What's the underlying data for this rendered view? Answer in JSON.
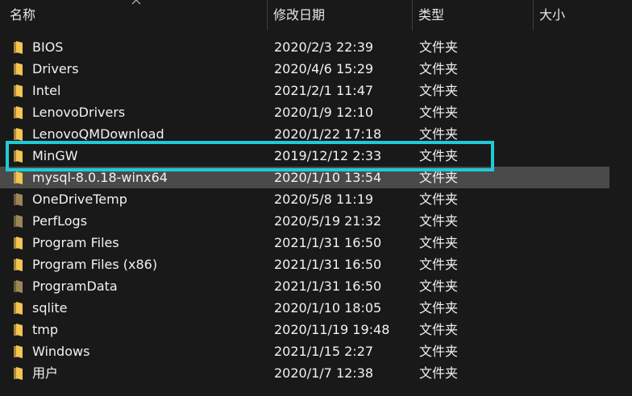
{
  "header": {
    "name_label": "名称",
    "date_label": "修改日期",
    "type_label": "类型",
    "size_label": "大小"
  },
  "colors": {
    "background": "#191919",
    "selected_row": "#4a4a4a",
    "highlight": "#1ecbd6",
    "folder_yellow": "#f5c451",
    "folder_dim": "#9c8656"
  },
  "rows": [
    {
      "name": "BIOS",
      "date": "2020/2/3 22:39",
      "type": "文件夹",
      "icon": "folder-icon"
    },
    {
      "name": "Drivers",
      "date": "2020/4/6 15:29",
      "type": "文件夹",
      "icon": "folder-icon"
    },
    {
      "name": "Intel",
      "date": "2021/2/1 11:47",
      "type": "文件夹",
      "icon": "folder-icon"
    },
    {
      "name": "LenovoDrivers",
      "date": "2020/1/9 12:10",
      "type": "文件夹",
      "icon": "folder-icon"
    },
    {
      "name": "LenovoQMDownload",
      "date": "2020/1/22 17:18",
      "type": "文件夹",
      "icon": "folder-icon"
    },
    {
      "name": "MinGW",
      "date": "2019/12/12 2:33",
      "type": "文件夹",
      "icon": "folder-icon"
    },
    {
      "name": "mysql-8.0.18-winx64",
      "date": "2020/1/10 13:54",
      "type": "文件夹",
      "icon": "folder-icon"
    },
    {
      "name": "OneDriveTemp",
      "date": "2020/5/8 11:19",
      "type": "文件夹",
      "icon": "folder-icon-dim"
    },
    {
      "name": "PerfLogs",
      "date": "2020/5/19 21:32",
      "type": "文件夹",
      "icon": "folder-icon-dim"
    },
    {
      "name": "Program Files",
      "date": "2021/1/31 16:50",
      "type": "文件夹",
      "icon": "folder-icon"
    },
    {
      "name": "Program Files (x86)",
      "date": "2021/1/31 16:50",
      "type": "文件夹",
      "icon": "folder-icon"
    },
    {
      "name": "ProgramData",
      "date": "2021/1/31 16:50",
      "type": "文件夹",
      "icon": "folder-icon-dim"
    },
    {
      "name": "sqlite",
      "date": "2020/1/10 18:05",
      "type": "文件夹",
      "icon": "folder-icon"
    },
    {
      "name": "tmp",
      "date": "2020/11/19 19:48",
      "type": "文件夹",
      "icon": "folder-icon"
    },
    {
      "name": "Windows",
      "date": "2021/1/15 2:27",
      "type": "文件夹",
      "icon": "folder-icon"
    },
    {
      "name": "用户",
      "date": "2020/1/7 12:38",
      "type": "文件夹",
      "icon": "folder-icon"
    }
  ]
}
